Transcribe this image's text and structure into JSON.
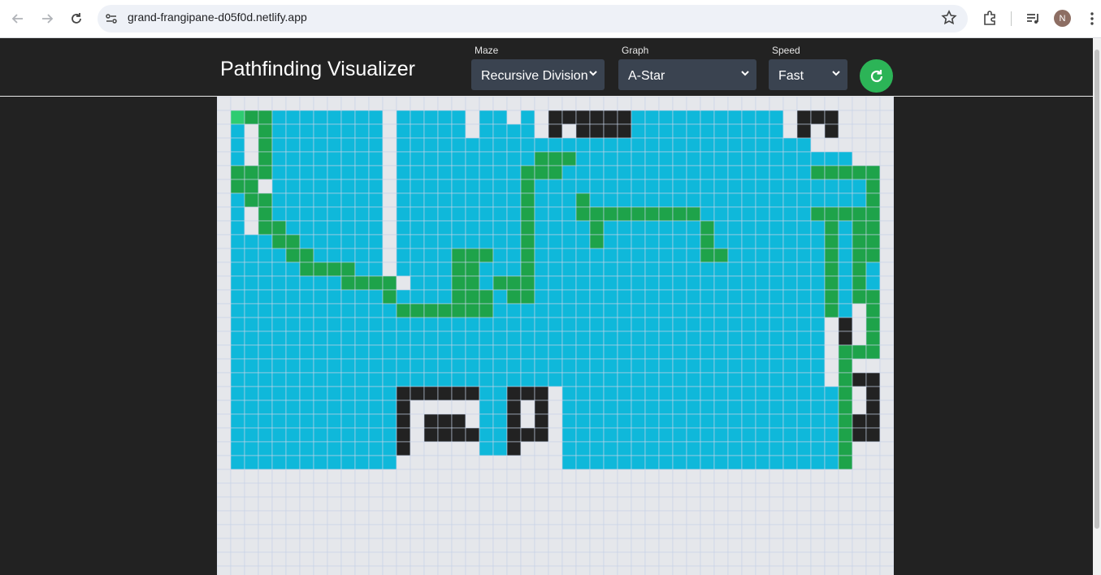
{
  "browser": {
    "url": "grand-frangipane-d05f0d.netlify.app",
    "avatar_initial": "N"
  },
  "app": {
    "title": "Pathfinding Visualizer",
    "maze": {
      "label": "Maze",
      "value": "Recursive Division"
    },
    "graph": {
      "label": "Graph",
      "value": "A-Star"
    },
    "speed": {
      "label": "Speed",
      "value": "Fast"
    }
  },
  "colors": {
    "empty": "#e5e7eb",
    "visited": "#0fb8da",
    "path": "#1ea34a",
    "wall": "#222222",
    "start": "#2ecc71",
    "gridline": "#c6d3e6"
  },
  "grid": {
    "cols": 49,
    "rows": 35,
    "start": [
      1,
      1
    ],
    "legend": {
      "0": "empty",
      "1": "visited",
      "2": "path",
      "3": "wall",
      "4": "start"
    },
    "cells": [
      "0000000000000000000000000000000000000000000000000",
      "0422111111110111110110103333331111111111103330000",
      "0102111111110111110111103033331111111111103030000",
      "0102111111110111111111111111111111111111111000000",
      "0102111111110111111111122211111111111111111111000",
      "0222111111110111111111222111111111111111111222220",
      "0220111111110111111111211111111111111111111111120",
      "0122111111110111111111211121111111111111111111120",
      "0102111111110111111111211122222222211111111222220",
      "0102211111110111111111211112111111121111111121220",
      "0111221111110111111111211112111111121111111121220",
      "0111122111110111122211211111111111122111111121220",
      "0111112222110111122111211111111111111111111121210",
      "0111111112222011122122211111111111111111111121210",
      "0111111111112111122212211111111111111111111121220",
      "0111111111111222222211111111111111111111111121020",
      "0111111111111111111111111111111111111111111103020",
      "0111111111111111111111111111111111111111111103020",
      "0111111111111111111111111111111111111111111102220",
      "0111111111111111111111111111111111111111111102000",
      "0111111111111111111111111111111111111111111102330",
      "0111111111111333333113330111111111111111111112030",
      "0111111111111300000113030111111111111111111112030",
      "0111111111111303330113030111111111111111111112330",
      "0111111111111303333113330111111111111111111112330",
      "0111111111111300000113000111111111111111111112000",
      "0111111111111000000000000111111111111111111112000",
      "0000000000000000000000000000000000000000000000000",
      "0000000000000000000000000000000000000000000000000",
      "0000000000000000000000000000000000000000000000000",
      "0000000000000000000000000000000000000000000000000",
      "0000000000000000000000000000000000000000000000000",
      "0000000000000000000000000000000000000000000000000",
      "0000000000000000000000000000000000000000000000000",
      "0000000000000000000000000000000000000000000000000"
    ]
  }
}
